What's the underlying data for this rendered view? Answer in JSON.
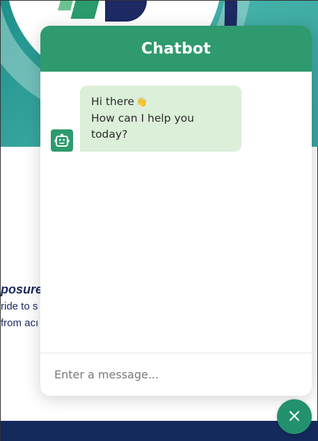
{
  "background": {
    "heading": "posure",
    "line1": "ride to s",
    "line2": "from acı"
  },
  "chatbot": {
    "title": "Chatbot",
    "messages": [
      {
        "sender": "bot",
        "icon": "robot-icon",
        "line1": "Hi there",
        "emoji": "👋",
        "line2": "How can I help you today?"
      }
    ],
    "input": {
      "value": "",
      "placeholder": "Enter a message..."
    },
    "toggler_icon": "close-icon"
  },
  "colors": {
    "header": "#2e9a6e",
    "bubble": "#dcefd9",
    "toggler": "#23906e",
    "navy": "#142a5c"
  }
}
